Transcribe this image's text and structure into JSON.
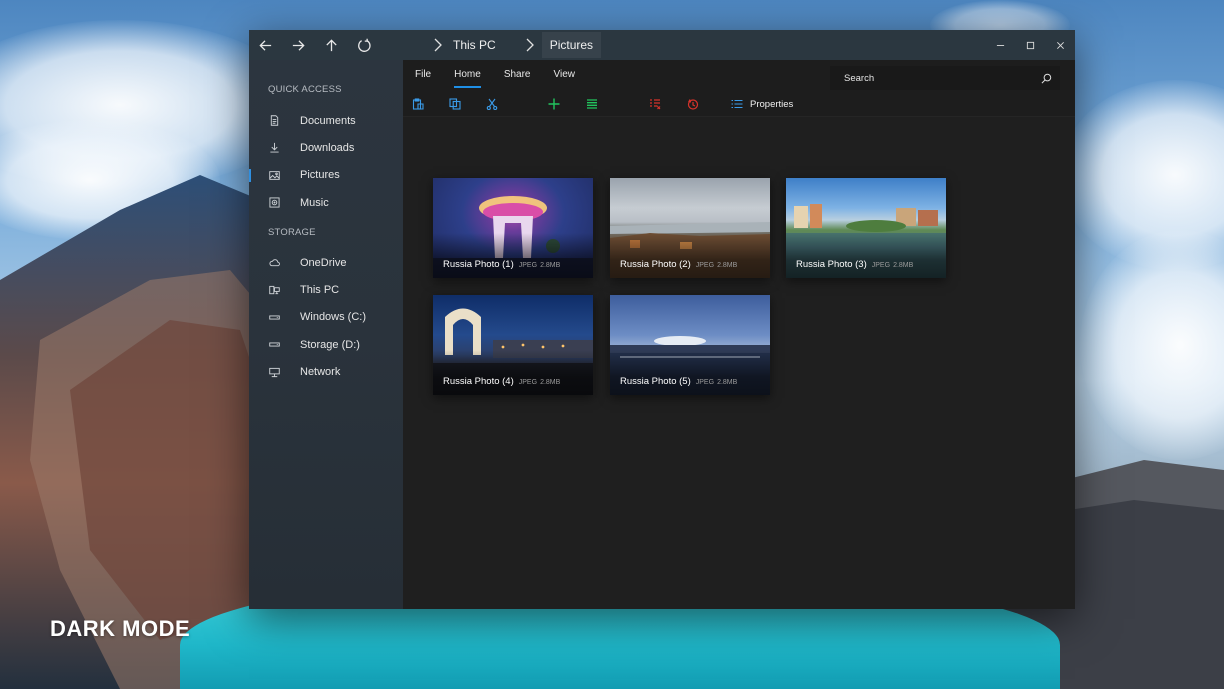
{
  "desktop": {
    "overlay_label": "DARK MODE"
  },
  "window": {
    "breadcrumbs": [
      "This PC",
      "Pictures"
    ],
    "nav": {
      "back_icon": "arrow-left",
      "forward_icon": "arrow-right",
      "up_icon": "arrow-up",
      "refresh_icon": "refresh"
    },
    "controls": [
      "minimize",
      "maximize",
      "close"
    ]
  },
  "sidebar": {
    "quick_access_header": "QUICK ACCESS",
    "quick_access": [
      {
        "label": "Documents",
        "icon": "document-icon"
      },
      {
        "label": "Downloads",
        "icon": "download-icon"
      },
      {
        "label": "Pictures",
        "icon": "picture-icon",
        "active": true
      },
      {
        "label": "Music",
        "icon": "music-icon"
      }
    ],
    "storage_header": "STORAGE",
    "storage": [
      {
        "label": "OneDrive",
        "icon": "cloud-icon"
      },
      {
        "label": "This PC",
        "icon": "pc-icon"
      },
      {
        "label": "Windows (C:)",
        "icon": "drive-icon"
      },
      {
        "label": "Storage (D:)",
        "icon": "drive-icon"
      },
      {
        "label": "Network",
        "icon": "network-icon"
      }
    ]
  },
  "ribbon": {
    "tabs": [
      "File",
      "Home",
      "Share",
      "View"
    ],
    "active_tab": "Home",
    "search_placeholder": "Search",
    "toolbar": {
      "properties_label": "Properties"
    },
    "colors": {
      "accent": "#1f8fe6",
      "new_green": "#22c55e",
      "delete_red": "#d9332b"
    }
  },
  "files": [
    {
      "name": "Russia Photo (1)",
      "type": "JPEG",
      "size": "2.8MB"
    },
    {
      "name": "Russia Photo (2)",
      "type": "JPEG",
      "size": "2.8MB"
    },
    {
      "name": "Russia Photo (3)",
      "type": "JPEG",
      "size": "2.8MB"
    },
    {
      "name": "Russia Photo (4)",
      "type": "JPEG",
      "size": "2.8MB"
    },
    {
      "name": "Russia Photo (5)",
      "type": "JPEG",
      "size": "2.8MB"
    }
  ]
}
